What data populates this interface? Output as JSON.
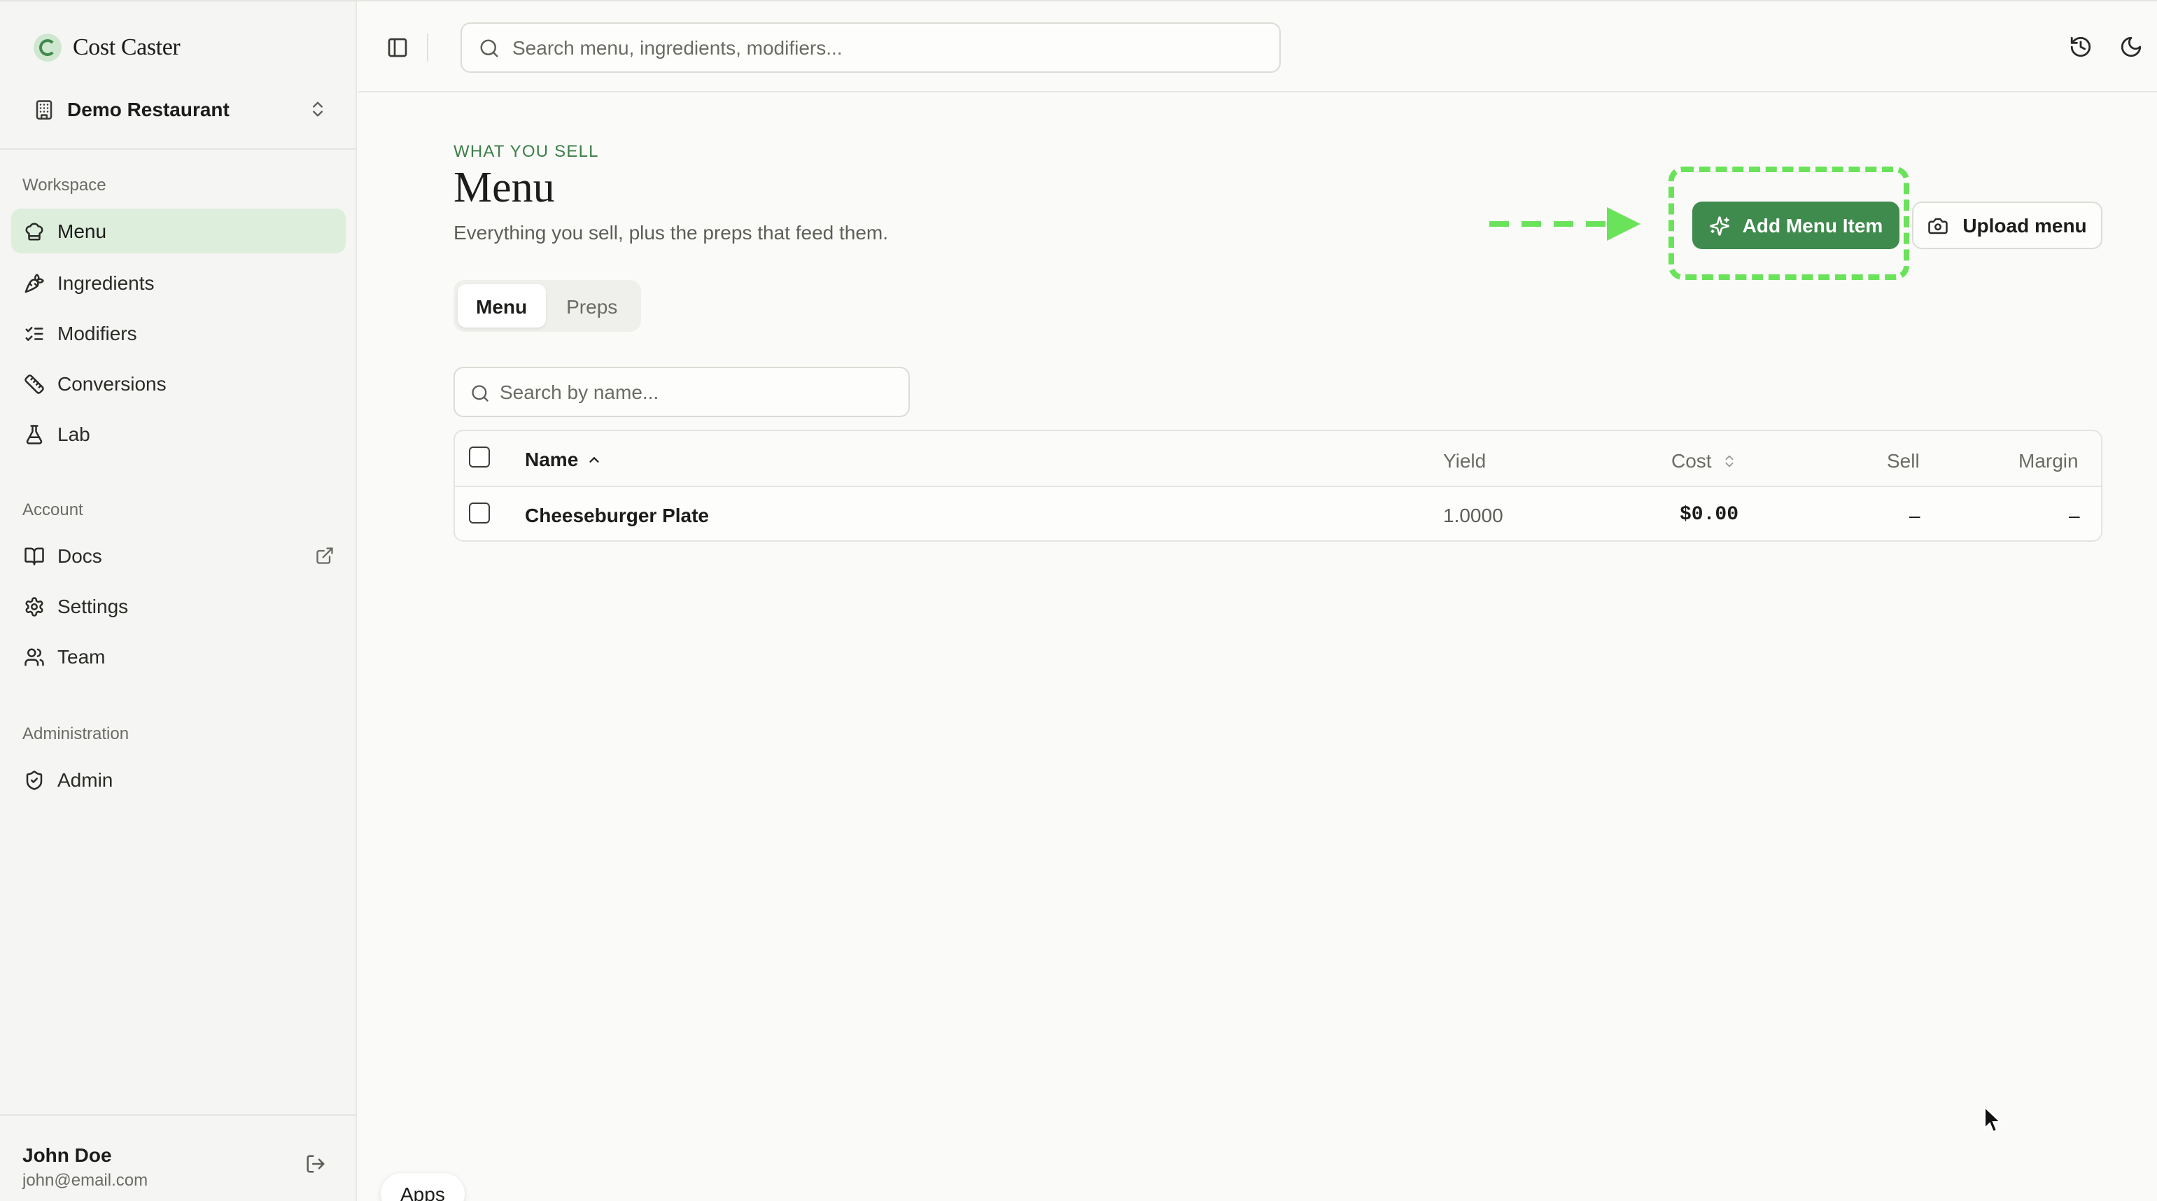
{
  "brand": {
    "name": "Cost Caster"
  },
  "org": {
    "name": "Demo Restaurant"
  },
  "sidebar": {
    "workspace_label": "Workspace",
    "workspace_items": [
      {
        "label": "Menu",
        "icon": "chef-hat-icon",
        "active": true
      },
      {
        "label": "Ingredients",
        "icon": "carrot-icon"
      },
      {
        "label": "Modifiers",
        "icon": "list-checks-icon"
      },
      {
        "label": "Conversions",
        "icon": "ruler-icon"
      },
      {
        "label": "Lab",
        "icon": "flask-icon"
      }
    ],
    "account_label": "Account",
    "account_items": [
      {
        "label": "Docs",
        "icon": "book-icon",
        "external": true
      },
      {
        "label": "Settings",
        "icon": "gear-icon"
      },
      {
        "label": "Team",
        "icon": "users-icon"
      }
    ],
    "admin_label": "Administration",
    "admin_items": [
      {
        "label": "Admin",
        "icon": "shield-check-icon"
      }
    ]
  },
  "user": {
    "name": "John Doe",
    "email": "john@email.com"
  },
  "topbar": {
    "search_placeholder": "Search menu, ingredients, modifiers..."
  },
  "page": {
    "eyebrow": "WHAT YOU SELL",
    "title": "Menu",
    "subtitle": "Everything you sell, plus the preps that feed them.",
    "add_button": "Add Menu Item",
    "upload_button": "Upload menu"
  },
  "tabs": [
    {
      "label": "Menu",
      "active": true
    },
    {
      "label": "Preps",
      "active": false
    }
  ],
  "table": {
    "search_placeholder": "Search by name...",
    "columns": {
      "name": "Name",
      "yield": "Yield",
      "cost": "Cost",
      "sell": "Sell",
      "margin": "Margin"
    },
    "rows": [
      {
        "name": "Cheeseburger Plate",
        "yield": "1.0000",
        "cost": "$0.00",
        "sell": "–",
        "margin": "–"
      }
    ]
  },
  "apps_pill": "Apps",
  "colors": {
    "accent": "#3f8a4d",
    "highlight": "#6ae25a",
    "active_nav_bg": "#ddeedd"
  }
}
